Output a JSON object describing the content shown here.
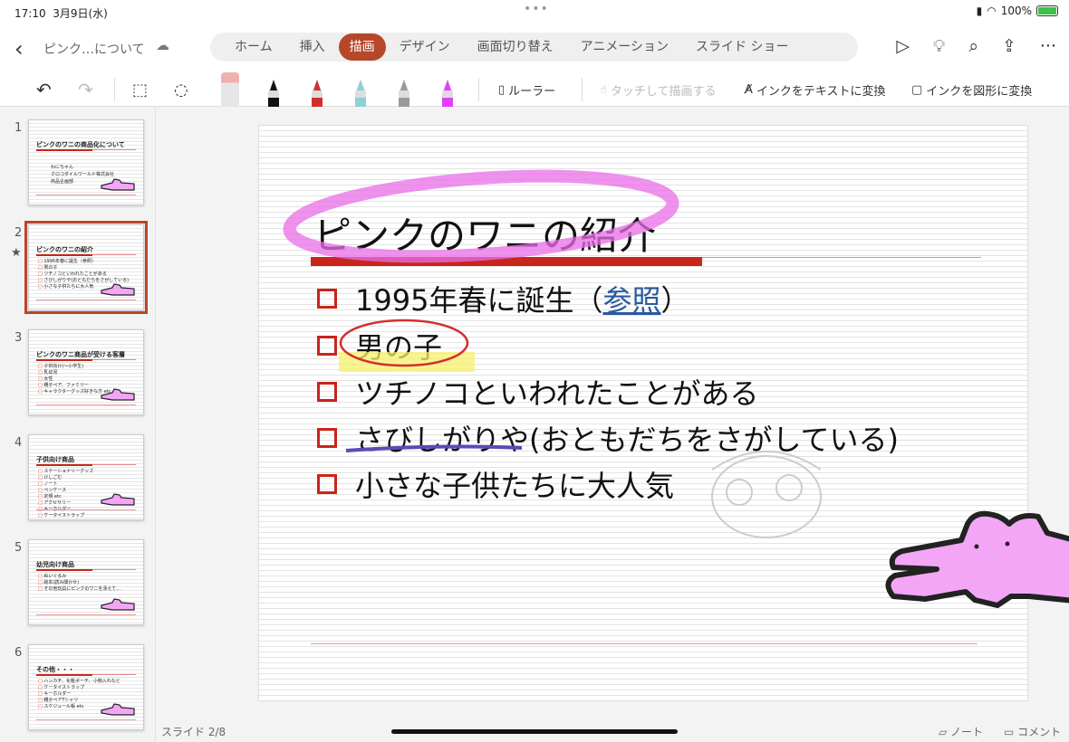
{
  "status": {
    "time": "17:10",
    "date": "3月9日(水)",
    "battery": "100%"
  },
  "header": {
    "doc_title": "ピンク…について",
    "tabs": [
      "ホーム",
      "挿入",
      "描画",
      "デザイン",
      "画面切り替え",
      "アニメーション",
      "スライド ショー"
    ],
    "active_tab": "描画"
  },
  "toolbar": {
    "ruler": "ルーラー",
    "touch_draw": "タッチして描画する",
    "ink_to_text": "インクをテキストに変換",
    "ink_to_shape": "インクを図形に変換",
    "pen_colors": [
      "#f0b0b0",
      "#111111",
      "#d32f2f",
      "#8fd0d8",
      "#9a9a9a",
      "#e040fb"
    ]
  },
  "slides": [
    {
      "num": "1",
      "title": "ピンクのワニの商品化について",
      "sub": [
        "わにちゃん",
        "クロコダイルワールド株式会社",
        "商品企画部"
      ]
    },
    {
      "num": "2",
      "title": "ピンクのワニの紹介",
      "items": [
        "1995年春に誕生（参照）",
        "男の子",
        "ツチノコといわれたことがある",
        "さびしがりや(おともだちをさがしている)",
        "小さな子供たちに大人気"
      ]
    },
    {
      "num": "3",
      "title": "ピンクのワニ商品が受ける客層",
      "items": [
        "子供向け(～小学生)",
        "乳幼児",
        "女性",
        "親子ペア、ファミリー",
        "キャラクターグッズ好きな方 etc"
      ]
    },
    {
      "num": "4",
      "title": "子供向け商品",
      "items": [
        "ステーショナリーグッズ",
        "けしごむ",
        "ノート",
        "ペンケース",
        "定規 etc",
        "アクセサリー",
        "キーホルダー",
        "ケータイストラップ"
      ]
    },
    {
      "num": "5",
      "title": "幼児向け商品",
      "items": [
        "ぬいぐるみ",
        "絵本(読み聞かせ)",
        "その他玩具にピンクのワニを添えて…"
      ]
    },
    {
      "num": "6",
      "title": "その他・・・",
      "items": [
        "ハンカチ、化粧ポーチ、小物入れなど",
        "ケータイストラップ",
        "キーホルダー",
        "親子ペアTシャツ",
        "スケジュール帳 etc"
      ]
    }
  ],
  "current_slide": {
    "title": "ピンクのワニの紹介",
    "b1_pre": "1995年春に誕生（",
    "b1_link": "参照",
    "b1_post": "）",
    "bullets": [
      "男の子",
      "ツチノコといわれたことがある",
      "さびしがりや(おともだちをさがしている)",
      "小さな子供たちに大人気"
    ]
  },
  "footer": {
    "slide_counter": "スライド 2/8",
    "notes": "ノート",
    "comments": "コメント"
  },
  "colors": {
    "accent": "#b7472a",
    "bullet": "#c8251b",
    "ink_pink": "#e86ee8",
    "croc": "#f3a6f6"
  }
}
